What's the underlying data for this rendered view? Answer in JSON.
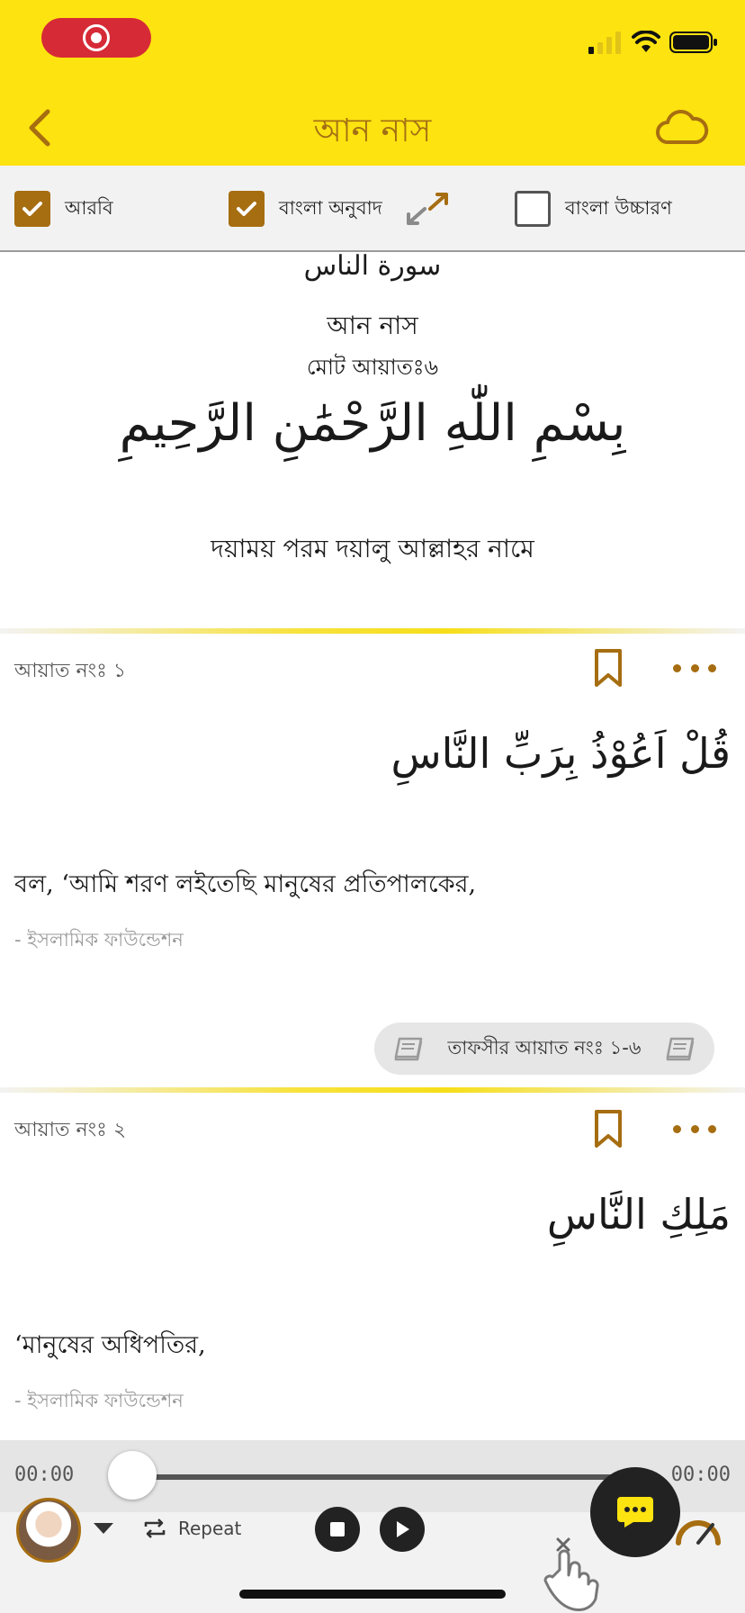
{
  "header": {
    "title": "আন নাস",
    "back_icon": "chevron-left-icon",
    "cloud_icon": "cloud-icon",
    "accent_color": "#fde30f",
    "brand_color": "#a66d11"
  },
  "options": [
    {
      "label": "আরবি",
      "checked": true
    },
    {
      "label": "বাংলা অনুবাদ",
      "checked": true
    },
    {
      "label": "বাংলা উচ্চারণ",
      "checked": false
    }
  ],
  "surah": {
    "arabic_name": "سورة الناس",
    "bangla_name": "আন নাস",
    "total_ayat": "মোট আয়াতঃ৬",
    "bismillah": "بِسْمِ اللّٰهِ الرَّحْمَٰنِ الرَّحِيمِ",
    "bismillah_translation": "দয়াময় পরম দয়ালু আল্লাহর নামে"
  },
  "ayat": [
    {
      "label": "আয়াত নংঃ ১",
      "arabic": "قُلْ اَعُوْذُ بِرَبِّ النَّاسِ",
      "translation": "বল, ‘আমি শরণ লইতেছি মানুষের প্রতিপালকের,",
      "source": "- ইসলামিক ফাউন্ডেশন",
      "tafsir": "তাফসীর আয়াত নংঃ ১-৬"
    },
    {
      "label": "আয়াত নংঃ ২",
      "arabic": "مَلِكِ النَّاسِ",
      "translation": "‘মানুষের অধিপতির,",
      "source": "- ইসলামিক ফাউন্ডেশন"
    }
  ],
  "player": {
    "current_time": "00:00",
    "total_time": "00:00",
    "progress": 0,
    "repeat_label": "Repeat"
  }
}
